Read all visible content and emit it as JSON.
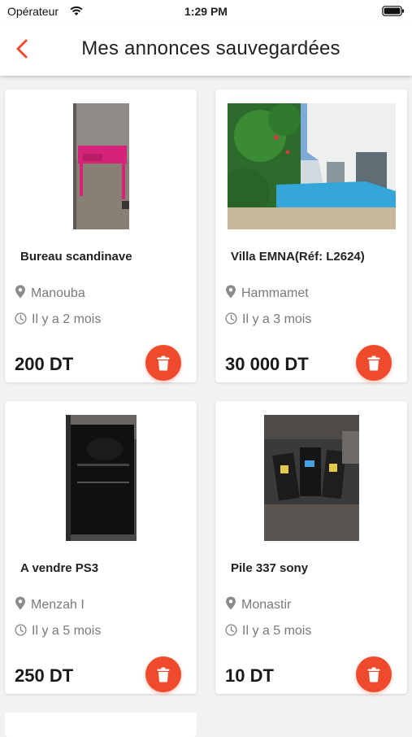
{
  "status": {
    "carrier": "Opérateur",
    "time": "1:29 PM"
  },
  "nav": {
    "title": "Mes annonces sauvegardées",
    "back_icon": "chevron-left-icon",
    "accent": "#f04a2c"
  },
  "listings": [
    {
      "title": "Bureau scandinave",
      "location": "Manouba",
      "posted": "Il y a 2 mois",
      "price": "200 DT"
    },
    {
      "title": "Villa EMNA(Réf: L2624)",
      "location": "Hammamet",
      "posted": "Il y a 3 mois",
      "price": "30 000 DT"
    },
    {
      "title": "A vendre PS3",
      "location": "Menzah I",
      "posted": "Il y a 5 mois",
      "price": "250 DT"
    },
    {
      "title": "Pile 337 sony",
      "location": "Monastir",
      "posted": "Il y a 5 mois",
      "price": "10 DT"
    }
  ],
  "icons": {
    "location": "map-pin-icon",
    "time": "clock-icon",
    "delete": "trash-icon"
  }
}
